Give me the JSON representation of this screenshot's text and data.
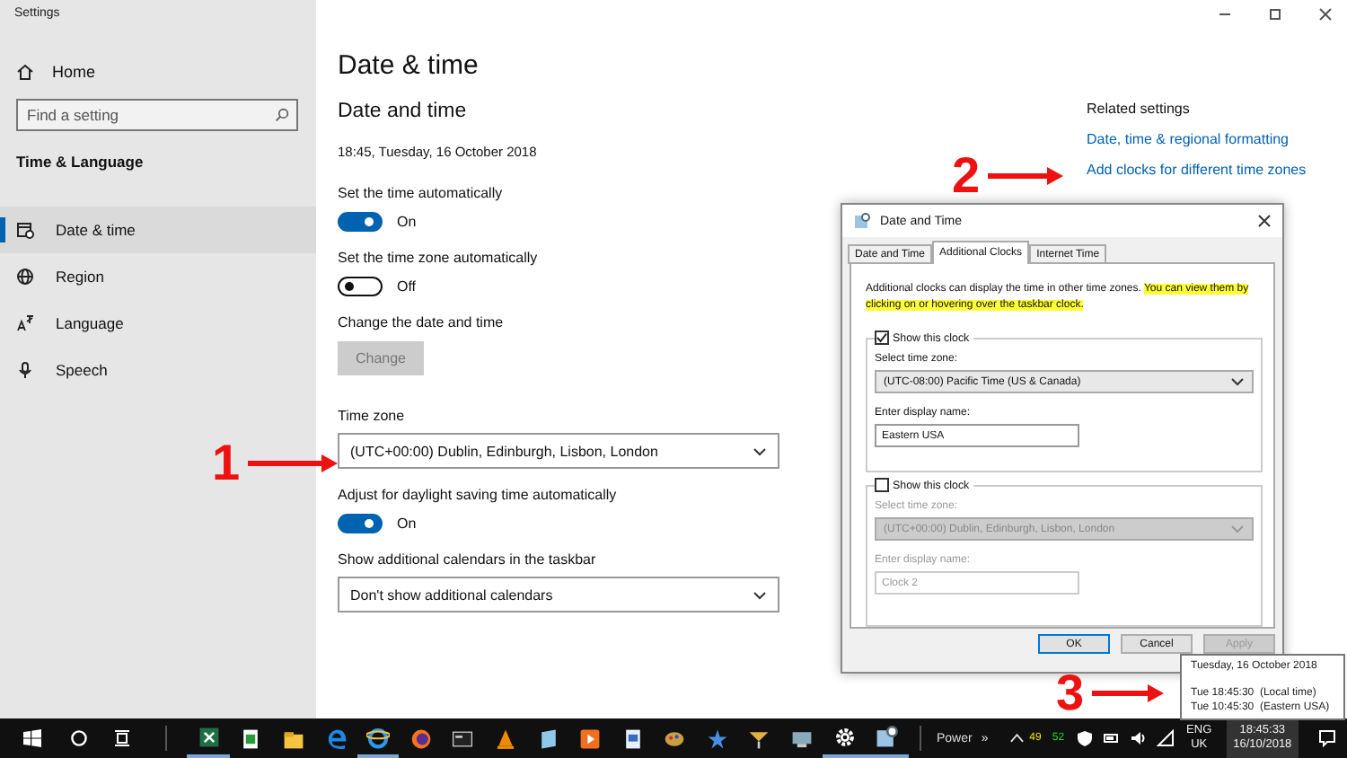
{
  "window": {
    "title": "Settings"
  },
  "sidebar": {
    "home": "Home",
    "search": {
      "placeholder": "Find a setting"
    },
    "section": "Time & Language",
    "items": [
      {
        "label": "Date & time",
        "kind": "calendar",
        "selected": true
      },
      {
        "label": "Region",
        "kind": "globe",
        "selected": false
      },
      {
        "label": "Language",
        "kind": "language",
        "selected": false
      },
      {
        "label": "Speech",
        "kind": "microphone",
        "selected": false
      }
    ]
  },
  "page": {
    "title": "Date & time",
    "section": "Date and time",
    "current": "18:45, Tuesday, 16 October 2018",
    "settings": [
      {
        "kind": "toggle",
        "label": "Set the time automatically",
        "on": true,
        "state_text": "On"
      },
      {
        "kind": "toggle",
        "label": "Set the time zone automatically",
        "on": false,
        "state_text": "Off"
      },
      {
        "kind": "button",
        "label": "Change the date and time",
        "button": "Change",
        "disabled": true
      },
      {
        "kind": "dropdown",
        "label": "Time zone",
        "value": "(UTC+00:00) Dublin, Edinburgh, Lisbon, London"
      },
      {
        "kind": "toggle",
        "label": "Adjust for daylight saving time automatically",
        "on": true,
        "state_text": "On"
      },
      {
        "kind": "dropdown",
        "label": "Show additional calendars in the taskbar",
        "value": "Don't show additional calendars"
      }
    ]
  },
  "related": {
    "title": "Related settings",
    "links": [
      "Date, time & regional formatting",
      "Add clocks for different time zones"
    ]
  },
  "dialog": {
    "title": "Date and Time",
    "tabs": [
      {
        "label": "Date and Time",
        "selected": false
      },
      {
        "label": "Additional Clocks",
        "selected": true
      },
      {
        "label": "Internet Time",
        "selected": false
      }
    ],
    "text": "Additional clocks can display the time in other time zones.",
    "highlighted_text": "You can view them by clicking on or hovering over the taskbar clock.",
    "clocks": [
      {
        "show": true,
        "label": "Show this clock",
        "zone_label": "Select time zone:",
        "zone": "(UTC-08:00) Pacific Time (US & Canada)",
        "name_label": "Enter display name:",
        "name": "Eastern USA"
      },
      {
        "show": false,
        "label": "Show this clock",
        "zone_label": "Select time zone:",
        "zone": "(UTC+00:00) Dublin, Edinburgh, Lisbon, London",
        "name_label": "Enter display name:",
        "name": "Clock 2"
      }
    ],
    "buttons": [
      {
        "label": "OK",
        "disabled": false
      },
      {
        "label": "Cancel",
        "disabled": false
      },
      {
        "label": "Apply",
        "disabled": true
      }
    ]
  },
  "tooltip": {
    "date": "Tuesday, 16 October 2018",
    "lines": [
      "Tue 18:45:30  (Local time)",
      "Tue 10:45:30  (Eastern USA)"
    ]
  },
  "annotations": [
    {
      "label": "1"
    },
    {
      "label": "2"
    },
    {
      "label": "3"
    }
  ],
  "taskbar": {
    "toolbar": "Power",
    "chevron": "»",
    "tray_numbers": [
      {
        "text": "49",
        "color": "#e8e800"
      },
      {
        "text": "52",
        "color": "#22dd22"
      }
    ],
    "language": "ENG",
    "region": "UK",
    "time": "18:45:33",
    "date": "16/10/2018"
  }
}
